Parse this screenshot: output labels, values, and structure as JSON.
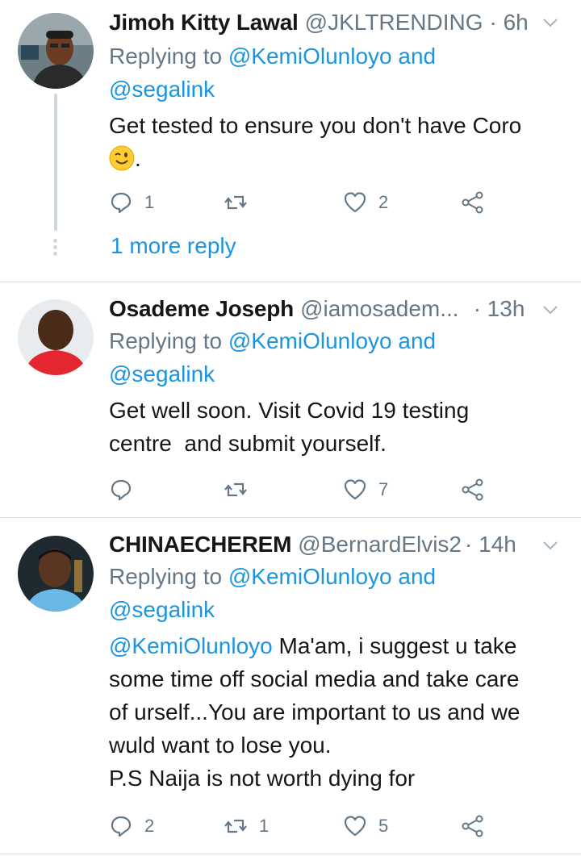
{
  "colors": {
    "link": "#1b95e0",
    "muted": "#657786",
    "text": "#14171a",
    "divider": "#d8dde1"
  },
  "tweets": [
    {
      "name": "Jimoh Kitty Lawal",
      "handle": "@JKLTRENDING",
      "time": "· 6h",
      "replying_prefix": "Replying to",
      "replying_mention1": "@KemiOlunloyo",
      "replying_and": "and",
      "replying_mention2": "@segalink",
      "body_line1": "Get tested to ensure you don't have Coro",
      "body_end": ".",
      "emoji": "winking-face",
      "reply_count": "1",
      "retweet_count": "",
      "like_count": "2",
      "more_replies": "1 more reply"
    },
    {
      "name": "Osademe Joseph",
      "handle": "@iamosadem...",
      "time": "· 13h",
      "replying_prefix": "Replying to",
      "replying_mention1": "@KemiOlunloyo",
      "replying_and": "and",
      "replying_mention2": "@segalink",
      "body_line1": "Get well soon. Visit Covid 19 testing",
      "body_line2": "centre  and submit yourself.",
      "reply_count": "",
      "retweet_count": "",
      "like_count": "7"
    },
    {
      "name": "CHINAECHEREM",
      "handle": "@BernardElvis2",
      "time": "· 14h",
      "replying_prefix": "Replying to",
      "replying_mention1": "@KemiOlunloyo",
      "replying_and": "and",
      "replying_mention2": "@segalink",
      "body_mention": "@KemiOlunloyo",
      "body_line1": " Ma'am, i suggest u take",
      "body_line2": "some time off social media and take care",
      "body_line3": "of urself...You are important to us and we",
      "body_line4": "wuld want to lose you.",
      "body_line5": "P.S Naija is not worth dying for",
      "reply_count": "2",
      "retweet_count": "1",
      "like_count": "5"
    }
  ]
}
